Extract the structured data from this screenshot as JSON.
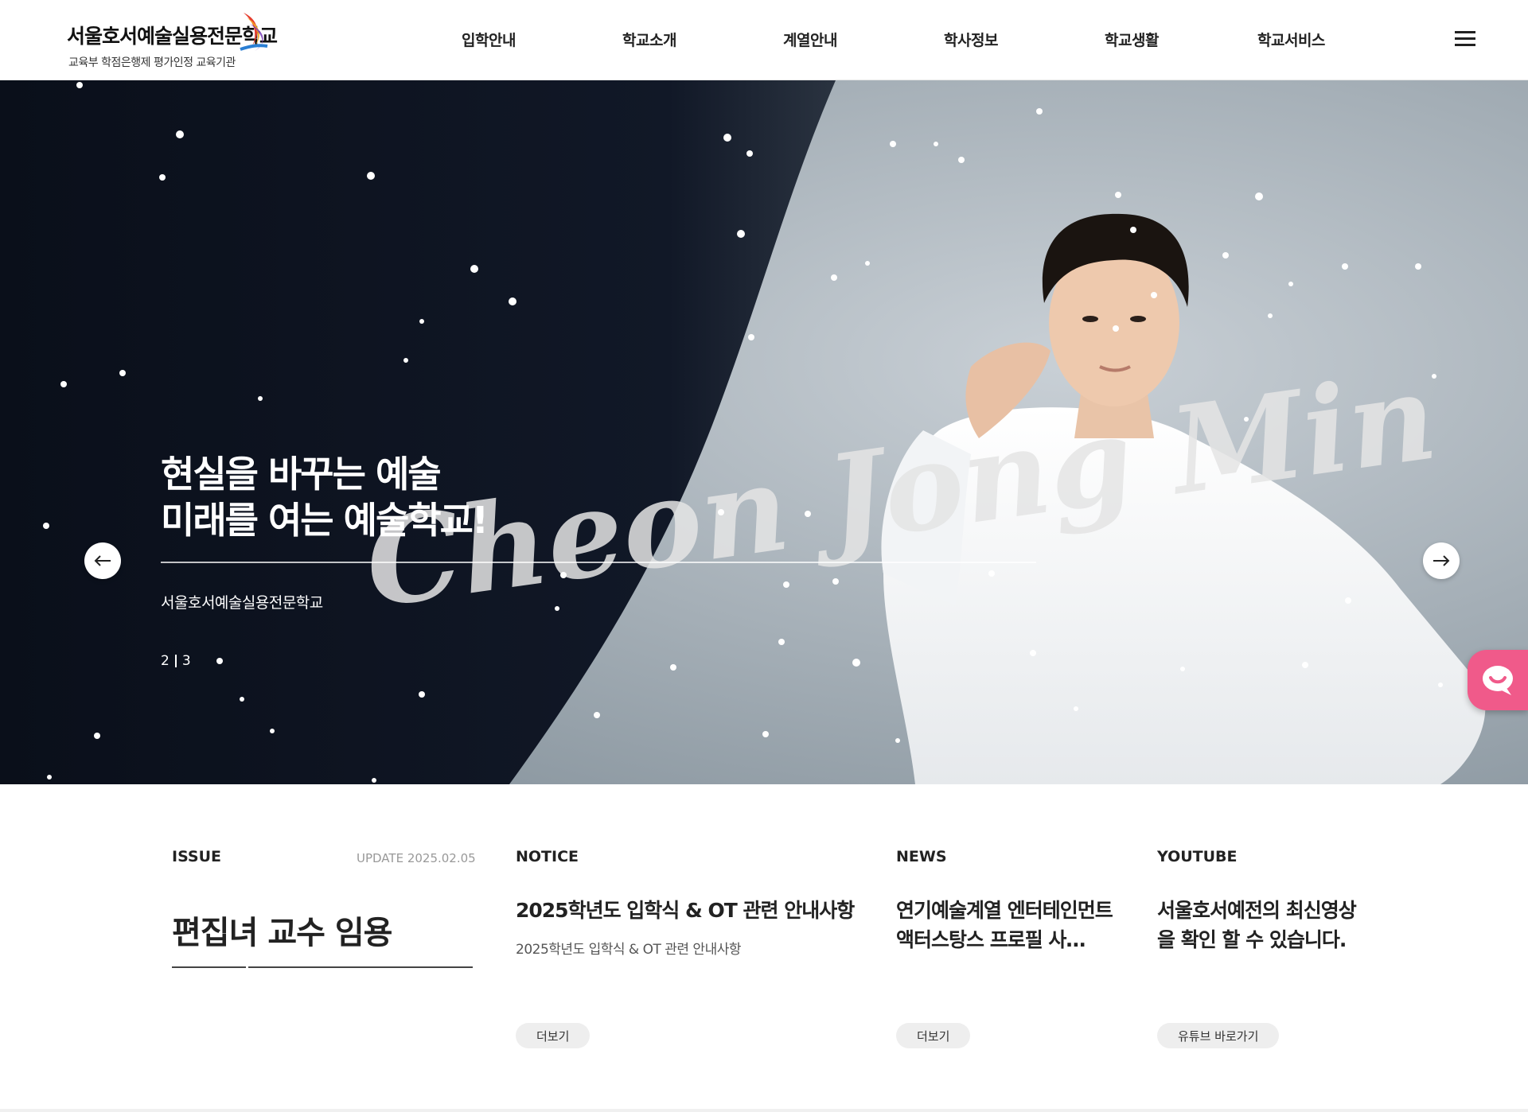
{
  "header": {
    "logo_title": "서울호서예술실용전문학교",
    "logo_sub": "교육부 학점은행제 평가인정 교육기관",
    "nav": [
      "입학안내",
      "학교소개",
      "계열안내",
      "학사정보",
      "학교생활",
      "학교서비스"
    ],
    "menu_icon": "hamburger-menu-icon"
  },
  "hero": {
    "headline": "현실을 바꾸는 예술\n미래를 여는 예술학교!",
    "script_name": "Cheon Jong Min",
    "subtitle": "서울호서예술실용전문학교",
    "pager": {
      "current": "2",
      "total": "3"
    },
    "prev_icon": "arrow-left-icon",
    "next_icon": "arrow-right-icon",
    "chat_icon": "chat-bubble-icon"
  },
  "issue": {
    "label": "ISSUE",
    "update": "UPDATE 2025.02.05",
    "title": "편집녀 교수 임용"
  },
  "notice": {
    "label": "NOTICE",
    "title": "2025학년도 입학식 & OT 관련 안내사항",
    "desc": "2025학년도 입학식 & OT 관련 안내사항",
    "more": "더보기"
  },
  "news": {
    "label": "NEWS",
    "title": "연기예술계열 엔터테인먼트 액터스탕스 프로필 사…",
    "more": "더보기"
  },
  "youtube": {
    "label": "YOUTUBE",
    "title": "서울호서예전의 최신영상을 확인 할 수 있습니다.",
    "more": "유튜브 바로가기"
  },
  "colors": {
    "accent_pink": "#f05a8a",
    "hero_dark": "#0d1320",
    "text_dark": "#222222"
  }
}
